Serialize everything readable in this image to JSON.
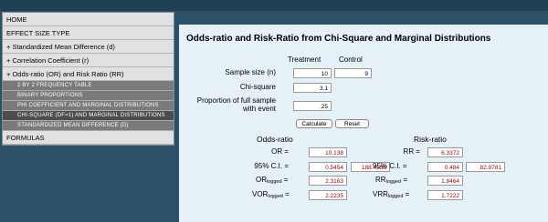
{
  "nav": {
    "home": "HOME",
    "effect_size_type": "EFFECT SIZE TYPE",
    "smd": "+ Standardized Mean Difference (d)",
    "corr": "+ Correlation Coefficient (r)",
    "odds": "+ Odds-ratio (OR) and Risk Ratio (RR)",
    "sub_items": [
      "2 by 2 frequency table",
      "Binary proportions",
      "Phi Coefficient and Marginal Distributions",
      "Chi-square (df=1) and Marginal Distributions",
      "Standardized mean difference (d)"
    ],
    "formulas": "FORMULAS"
  },
  "main": {
    "title": "Odds-ratio and Risk-Ratio from Chi-Square and Marginal Distributions",
    "col_treatment": "Treatment",
    "col_control": "Control",
    "sample_size_label": "Sample size (n)",
    "sample_treatment": "10",
    "sample_control": "9",
    "chi_label": "Chi-square",
    "chi_value": "3.1",
    "prop_label_1": "Proportion of full sample",
    "prop_label_2": "with event",
    "prop_value": ".25",
    "calculate": "Calculate",
    "reset": "Reset",
    "odds_heading": "Odds-ratio",
    "risk_heading": "Risk-ratio",
    "or_label": "OR =",
    "or_value": "10.138",
    "rr_label": "RR =",
    "rr_value": "6.3372",
    "ci_label": "95% C.I. =",
    "or_ci_low": "0.5454",
    "or_ci_high": "188.4538",
    "rr_ci_low": "0.484",
    "rr_ci_high": "82.9781",
    "or_logged_main": "OR",
    "rr_logged_main": "RR",
    "logged_sub": "logged",
    "eq": "=",
    "or_logged_value": "2.3163",
    "rr_logged_value": "1.8464",
    "var_or_main": "VOR",
    "var_rr_main": "VRR",
    "or_var_value": "2.2235",
    "rr_var_value": "1.7222"
  }
}
